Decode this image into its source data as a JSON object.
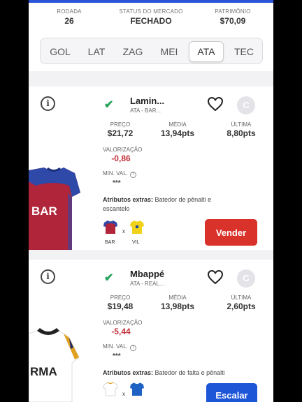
{
  "stats": {
    "rodada_label": "RODADA",
    "rodada_value": "26",
    "status_label": "STATUS DO MERCADO",
    "status_value": "FECHADO",
    "patrimonio_label": "PATRIMÔNIO",
    "patrimonio_value": "$70,09"
  },
  "tabs": [
    {
      "label": "GOL",
      "active": false
    },
    {
      "label": "LAT",
      "active": false
    },
    {
      "label": "ZAG",
      "active": false
    },
    {
      "label": "MEI",
      "active": false
    },
    {
      "label": "ATA",
      "active": true
    },
    {
      "label": "TEC",
      "active": false
    }
  ],
  "players": [
    {
      "name": "Lamin...",
      "team_info": "ATA - BAR...",
      "badge": "C",
      "price_label": "PREÇO",
      "price": "$21,72",
      "avg_label": "MÉDIA",
      "avg": "13,94pts",
      "last_label": "ÚLTIMA",
      "last": "8,80pts",
      "valz_label": "VALORIZAÇÃO",
      "valz": "-0,86",
      "minval_label": "MIN. VAL.",
      "minval": "***",
      "attrs_label": "Atributos extras:",
      "attrs": "Batedor de pênalti e escantelo",
      "jersey_text": "BAR",
      "home": "BAR",
      "away": "VIL",
      "vs": "x",
      "action": "Vender"
    },
    {
      "name": "Mbappé",
      "team_info": "ATA - REAL...",
      "badge": "C",
      "price_label": "PREÇO",
      "price": "$19,48",
      "avg_label": "MÉDIA",
      "avg": "13,98pts",
      "last_label": "ÚLTIMA",
      "last": "2,60pts",
      "valz_label": "VALORIZAÇÃO",
      "valz": "-5,44",
      "minval_label": "MIN. VAL.",
      "minval": "***",
      "attrs_label": "Atributos extras:",
      "attrs": "Batedor de falta e pênalti",
      "jersey_text": "RMA",
      "vs": "x",
      "action": "Escalar"
    }
  ],
  "icons": {
    "info": "info-icon",
    "check": "check-icon",
    "heart": "heart-icon",
    "help": "question-icon"
  },
  "colors": {
    "accent_blue": "#2c54d6",
    "sell_red": "#d9322a",
    "negative": "#c0313a",
    "check_green": "#27a35a"
  }
}
